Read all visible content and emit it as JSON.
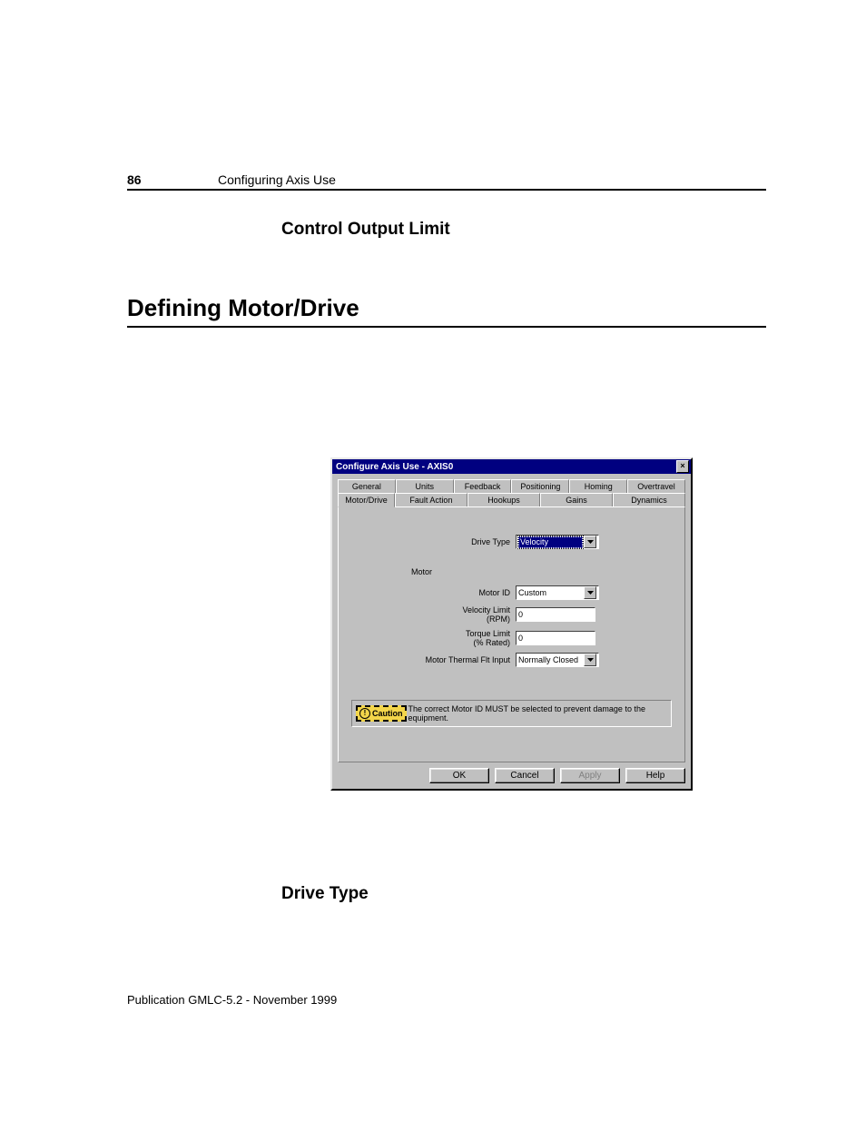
{
  "header": {
    "page_number": "86",
    "title": "Configuring Axis Use"
  },
  "headings": {
    "h3a": "Control Output Limit",
    "h1": "Defining Motor/Drive",
    "h3b": "Drive Type"
  },
  "dialog": {
    "title": "Configure Axis Use - AXIS0",
    "close_glyph": "×",
    "tabs_row1": [
      "General",
      "Units",
      "Feedback",
      "Positioning",
      "Homing",
      "Overtravel"
    ],
    "tabs_row2": [
      "Motor/Drive",
      "Fault Action",
      "Hookups",
      "Gains",
      "Dynamics"
    ],
    "active_tab": "Motor/Drive",
    "drive_type_label": "Drive Type",
    "drive_type_value": "Velocity",
    "motor_group_label": "Motor",
    "motor_id_label": "Motor ID",
    "motor_id_value": "Custom",
    "velocity_limit_label": "Velocity Limit\n(RPM)",
    "velocity_limit_value": "0",
    "torque_limit_label": "Torque Limit\n(% Rated)",
    "torque_limit_value": "0",
    "thermal_label": "Motor Thermal Flt Input",
    "thermal_value": "Normally Closed",
    "caution_label": "Caution",
    "caution_text": "The correct Motor ID MUST be selected to prevent damage to the equipment.",
    "buttons": {
      "ok": "OK",
      "cancel": "Cancel",
      "apply": "Apply",
      "help": "Help"
    }
  },
  "footer": "Publication GMLC-5.2 - November 1999"
}
